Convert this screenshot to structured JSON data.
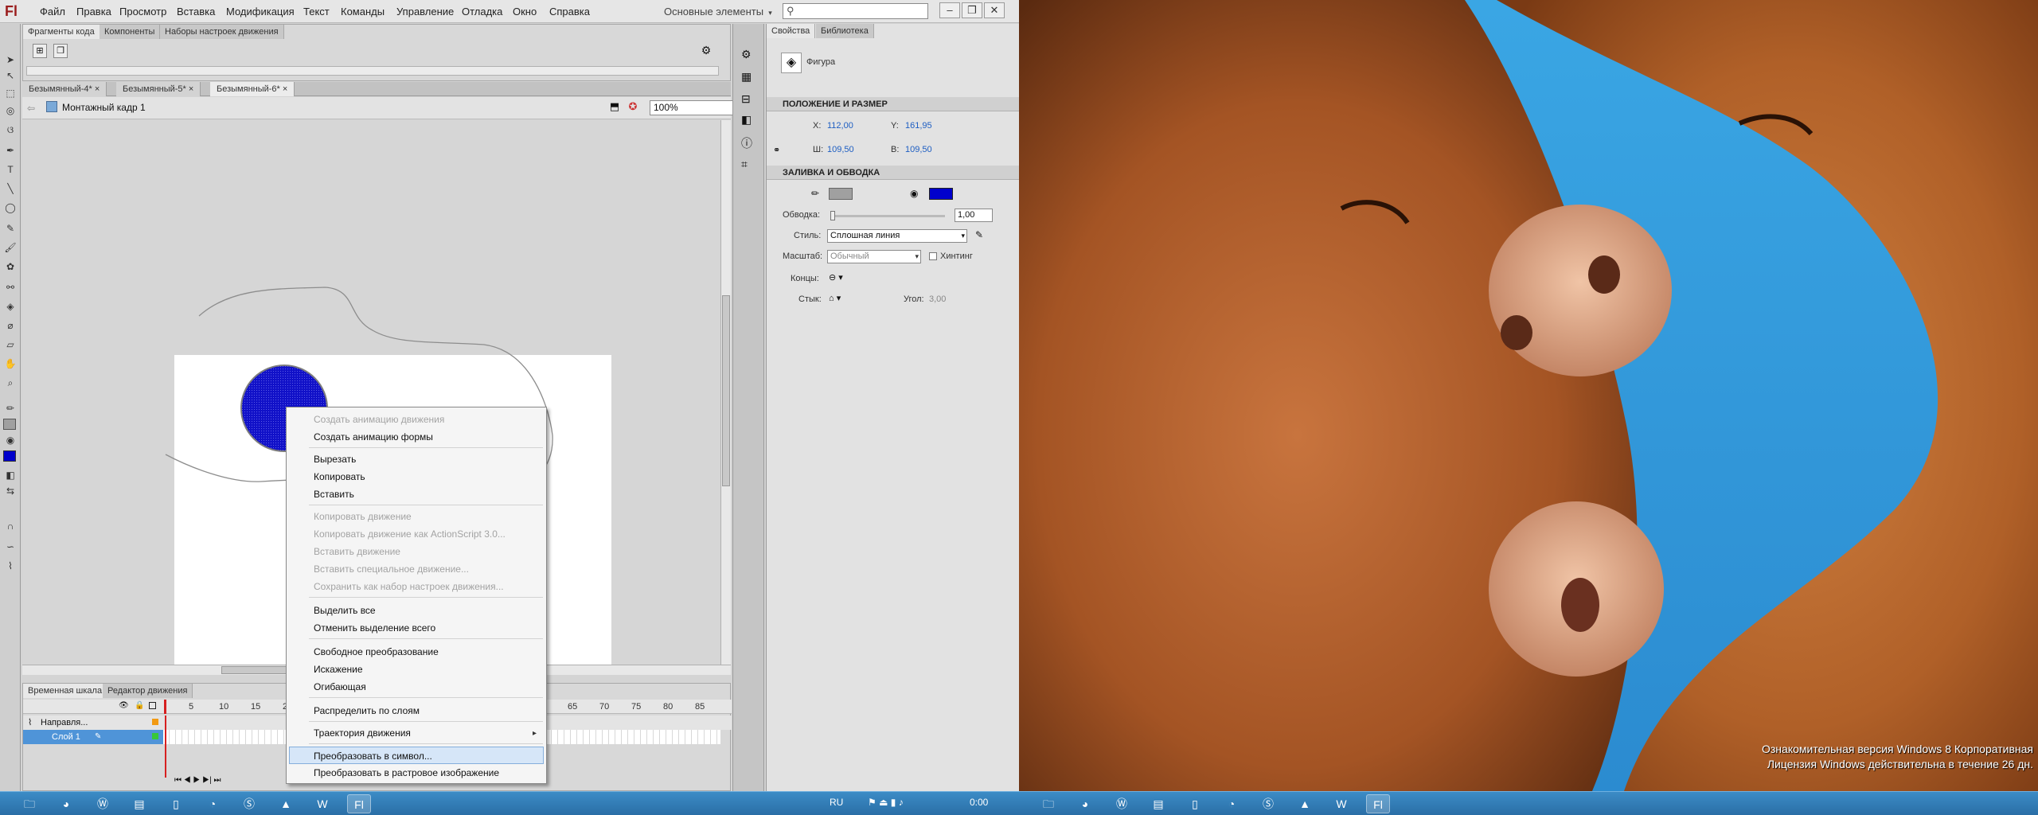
{
  "app": {
    "logo": "Fl",
    "menu": [
      "Файл",
      "Правка",
      "Просмотр",
      "Вставка",
      "Модификация",
      "Текст",
      "Команды",
      "Управление",
      "Отладка",
      "Окно",
      "Справка"
    ],
    "workspace": "Основные элементы",
    "search_value": "",
    "window_buttons": [
      "–",
      "❐",
      "✕"
    ]
  },
  "snippet_panel": {
    "tabs": [
      "Фрагменты кода",
      "Компоненты",
      "Наборы настроек движения"
    ]
  },
  "doc_tabs": [
    {
      "label": "Безымянный-4*",
      "close": "×"
    },
    {
      "label": "Безымянный-5*",
      "close": "×"
    },
    {
      "label": "Безымянный-6*",
      "close": "×"
    }
  ],
  "scene": {
    "label": "Монтажный кадр 1",
    "zoom": "100%"
  },
  "timeline": {
    "tabs": [
      "Временная шкала",
      "Редактор движения"
    ],
    "frame_numbers": [
      "5",
      "10",
      "15",
      "2",
      "65",
      "70",
      "75",
      "80",
      "85"
    ],
    "layers": [
      {
        "name": "Направля..."
      },
      {
        "name": "Слой 1"
      }
    ],
    "controls": [
      "⏮",
      "◀",
      "▶",
      "▶|",
      "⏭"
    ]
  },
  "properties": {
    "tabs": [
      "Свойства",
      "Библиотека"
    ],
    "object_type": "Фигура",
    "section_position": "ПОЛОЖЕНИЕ И РАЗМЕР",
    "x_label": "X:",
    "x_value": "112,00",
    "y_label": "Y:",
    "y_value": "161,95",
    "w_label": "Ш:",
    "w_value": "109,50",
    "h_label": "В:",
    "h_value": "109,50",
    "section_fill": "ЗАЛИВКА И ОБВОДКА",
    "stroke_label": "Обводка:",
    "stroke_value": "1,00",
    "style_label": "Стиль:",
    "style_value": "Сплошная линия",
    "scale_label": "Масштаб:",
    "scale_value": "Обычный",
    "hinting_label": "Хинтинг",
    "caps_label": "Концы:",
    "join_label": "Стык:",
    "angle_label": "Угол:",
    "angle_value": "3,00",
    "stroke_color": "#a0a0a0",
    "fill_color": "#0000cc"
  },
  "context_menu": {
    "items": [
      {
        "label": "Создать анимацию движения",
        "disabled": true
      },
      {
        "label": "Создать анимацию формы",
        "disabled": false
      },
      {
        "label": "Вырезать",
        "disabled": false
      },
      {
        "label": "Копировать",
        "disabled": false
      },
      {
        "label": "Вставить",
        "disabled": false
      },
      {
        "label": "Копировать движение",
        "disabled": true
      },
      {
        "label": "Копировать движение как ActionScript 3.0...",
        "disabled": true
      },
      {
        "label": "Вставить движение",
        "disabled": true
      },
      {
        "label": "Вставить специальное движение...",
        "disabled": true
      },
      {
        "label": "Сохранить как набор настроек движения...",
        "disabled": true
      },
      {
        "label": "Выделить все",
        "disabled": false
      },
      {
        "label": "Отменить выделение всего",
        "disabled": false
      },
      {
        "label": "Свободное преобразование",
        "disabled": false
      },
      {
        "label": "Искажение",
        "disabled": false
      },
      {
        "label": "Огибающая",
        "disabled": false
      },
      {
        "label": "Распределить по слоям",
        "disabled": false
      },
      {
        "label": "Траектория движения",
        "disabled": false
      },
      {
        "label": "Преобразовать в символ...",
        "disabled": false
      },
      {
        "label": "Преобразовать в растровое изображение",
        "disabled": false
      }
    ],
    "submenu_arrow": "▸"
  },
  "desktop": {
    "watermark_line1": "Ознакомительная версия Windows 8 Корпоративная",
    "watermark_line2": "Лицензия Windows действительна в течение 26 дн."
  },
  "taskbar": {
    "apps": [
      "explorer-icon",
      "chrome-icon",
      "wordpress-icon",
      "notepad-icon",
      "file-icon",
      "chrome2-icon",
      "acrobat-icon",
      "skype-icon",
      "word-icon",
      "flash-icon"
    ],
    "tray_lang": "RU",
    "tray_clock": "0:00"
  }
}
